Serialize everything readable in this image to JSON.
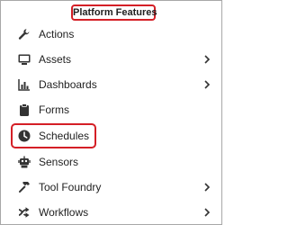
{
  "panel": {
    "title": "Platform Features",
    "accent_color": "#d41f26",
    "items": [
      {
        "label": "Actions",
        "icon": "wrench-icon",
        "has_submenu": false
      },
      {
        "label": "Assets",
        "icon": "monitor-icon",
        "has_submenu": true
      },
      {
        "label": "Dashboards",
        "icon": "bar-chart-icon",
        "has_submenu": true
      },
      {
        "label": "Forms",
        "icon": "clipboard-icon",
        "has_submenu": false
      },
      {
        "label": "Schedules",
        "icon": "clock-icon",
        "has_submenu": false,
        "highlighted": true
      },
      {
        "label": "Sensors",
        "icon": "robot-icon",
        "has_submenu": false
      },
      {
        "label": "Tool Foundry",
        "icon": "hammer-icon",
        "has_submenu": true
      },
      {
        "label": "Workflows",
        "icon": "flow-arrows-icon",
        "has_submenu": true
      }
    ]
  }
}
